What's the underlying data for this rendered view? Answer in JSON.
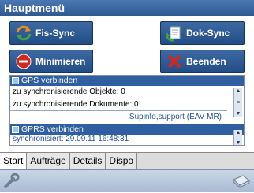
{
  "window": {
    "title": "Hauptmenü"
  },
  "buttons": {
    "fis_sync": "Fis-Sync",
    "dok_sync": "Dok-Sync",
    "minimieren": "Minimieren",
    "beenden": "Beenden"
  },
  "list": {
    "gps_header": "GPS verbinden",
    "objekte": "zu synchronisierende Objekte: 0",
    "dokumente": "zu synchronisierende Dokumente: 0",
    "support": "Supinfo,support (EAV MR)",
    "gprs_header": "GPRS verbinden",
    "last_sync": "synchronisiert: 29.09.11 16:48:31"
  },
  "tabs": [
    "Start",
    "Aufträge",
    "Details",
    "Dispo"
  ],
  "colors": {
    "title_bar": "#2e5a94",
    "button": "#2b5590",
    "accent_red": "#d0281a"
  },
  "icons": [
    "sync-arrows-icon",
    "document-sync-icon",
    "minus-circle-icon",
    "close-x-icon",
    "wrench-icon",
    "keyboard-icon"
  ]
}
